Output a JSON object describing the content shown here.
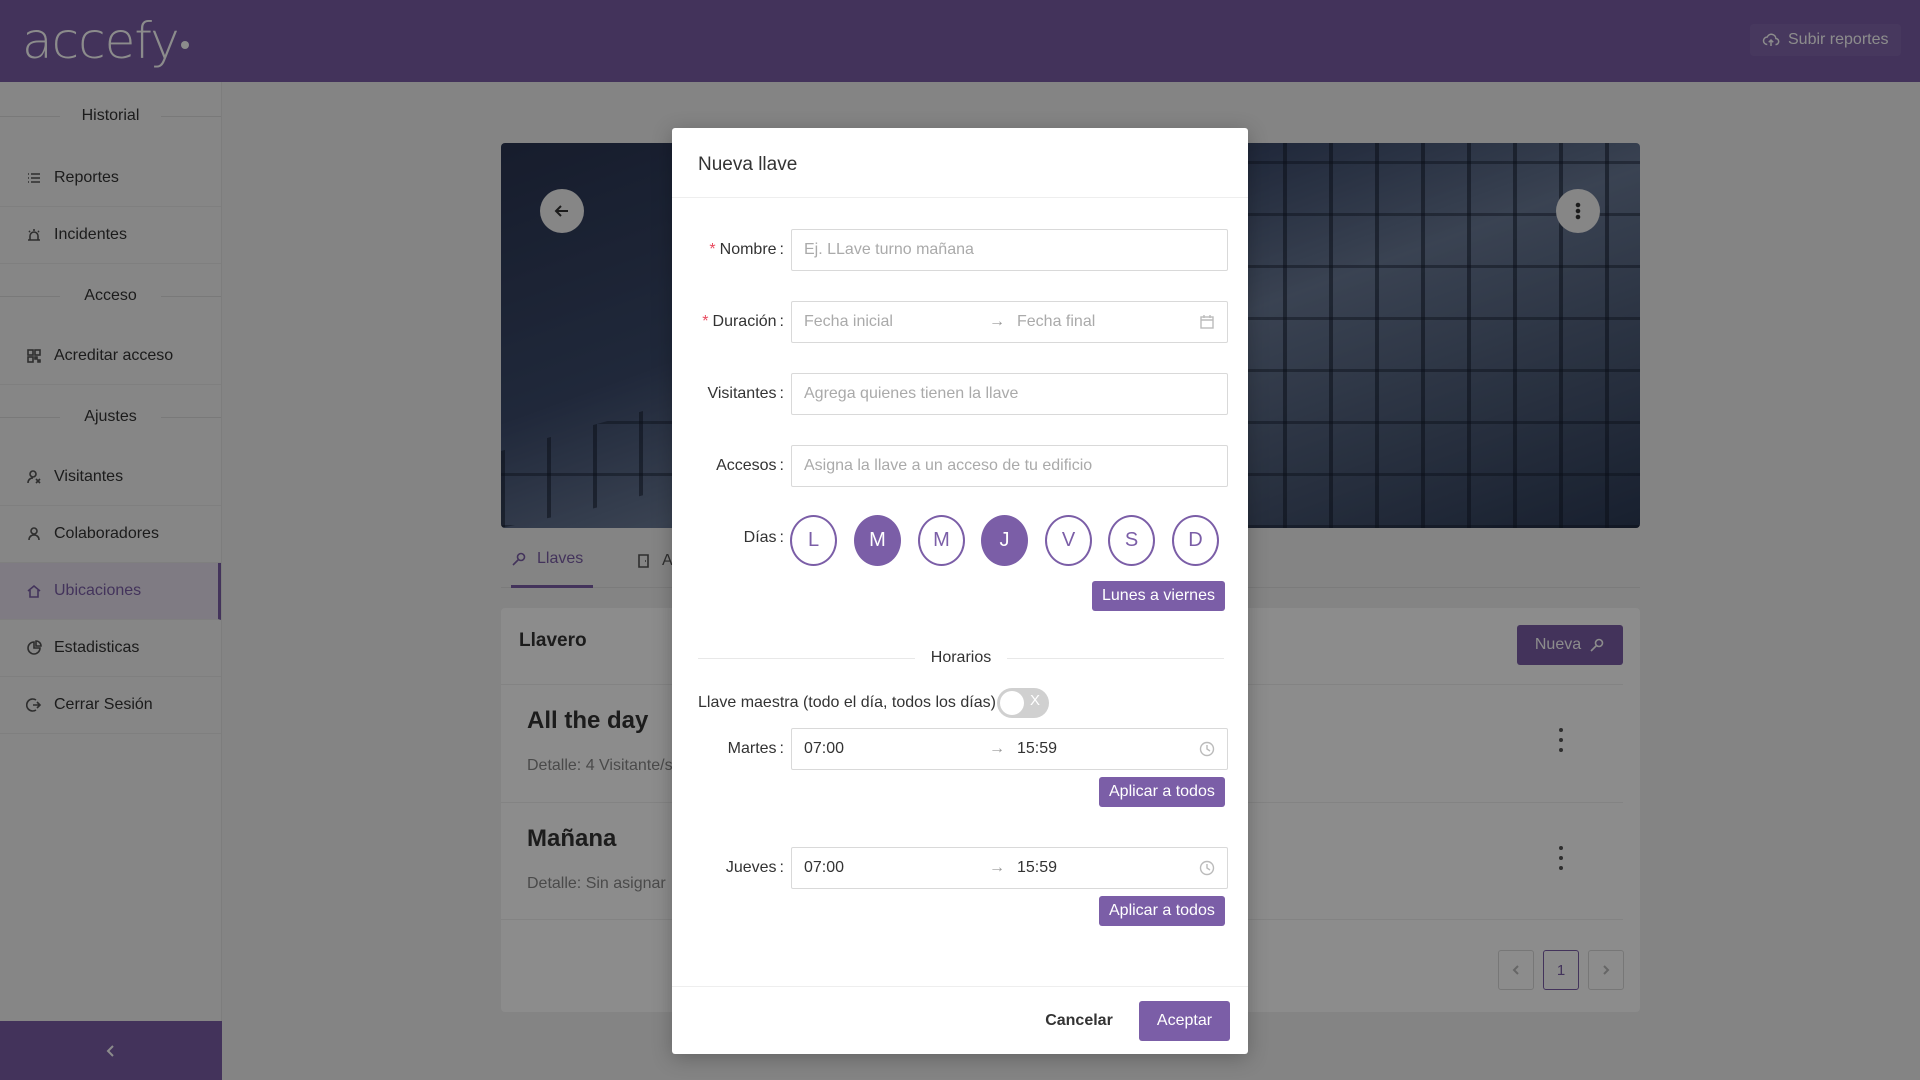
{
  "header": {
    "logo": "accefy",
    "upload_label": "Subir reportes"
  },
  "sidebar": {
    "sections": [
      {
        "label": "Historial"
      },
      {
        "label": "Acceso"
      },
      {
        "label": "Ajustes"
      }
    ],
    "items": [
      {
        "label": "Reportes",
        "icon": "list-icon"
      },
      {
        "label": "Incidentes",
        "icon": "alarm-icon"
      },
      {
        "label": "Acreditar acceso",
        "icon": "qr-icon"
      },
      {
        "label": "Visitantes",
        "icon": "visitor-icon"
      },
      {
        "label": "Colaboradores",
        "icon": "user-icon"
      },
      {
        "label": "Ubicaciones",
        "icon": "home-icon",
        "active": true
      },
      {
        "label": "Estadisticas",
        "icon": "pie-chart-icon"
      },
      {
        "label": "Cerrar Sesión",
        "icon": "logout-icon"
      }
    ]
  },
  "main": {
    "tabs": [
      {
        "label": "Llaves",
        "active": true
      },
      {
        "label": "A"
      }
    ],
    "card_title": "Llavero",
    "new_button": "Nueva",
    "rows": [
      {
        "title": "All the day",
        "detail": "Detalle: 4 Visitante/s"
      },
      {
        "title": "Mañana",
        "detail": "Detalle: Sin asignar"
      }
    ],
    "pagination": {
      "current": "1"
    }
  },
  "modal": {
    "title": "Nueva llave",
    "fields": {
      "nombre": {
        "label": "Nombre",
        "required": true,
        "placeholder": "Ej. LLave turno mañana"
      },
      "duracion": {
        "label": "Duración",
        "required": true,
        "start_placeholder": "Fecha inicial",
        "end_placeholder": "Fecha final"
      },
      "visitantes": {
        "label": "Visitantes",
        "placeholder": "Agrega quienes tienen la llave"
      },
      "accesos": {
        "label": "Accesos",
        "placeholder": "Asigna la llave a un acceso de tu edificio"
      },
      "dias": {
        "label": "Días"
      }
    },
    "days": [
      {
        "letter": "L",
        "selected": false
      },
      {
        "letter": "M",
        "selected": true
      },
      {
        "letter": "M",
        "selected": false
      },
      {
        "letter": "J",
        "selected": true
      },
      {
        "letter": "V",
        "selected": false
      },
      {
        "letter": "S",
        "selected": false
      },
      {
        "letter": "D",
        "selected": false
      }
    ],
    "weekdays_button": "Lunes a viernes",
    "schedule_divider": "Horarios",
    "master_key": {
      "label": "Llave maestra (todo el día, todos los días)",
      "enabled": false,
      "toggle_off_symbol": "X"
    },
    "schedules": [
      {
        "day": "Martes",
        "start": "07:00",
        "end": "15:59",
        "apply_label": "Aplicar a todos"
      },
      {
        "day": "Jueves",
        "start": "07:00",
        "end": "15:59",
        "apply_label": "Aplicar a todos"
      }
    ],
    "range_arrow": "→",
    "cancel_label": "Cancelar",
    "ok_label": "Aceptar"
  },
  "colors": {
    "primary": "#7b5ea7",
    "required": "#e84a5f"
  }
}
